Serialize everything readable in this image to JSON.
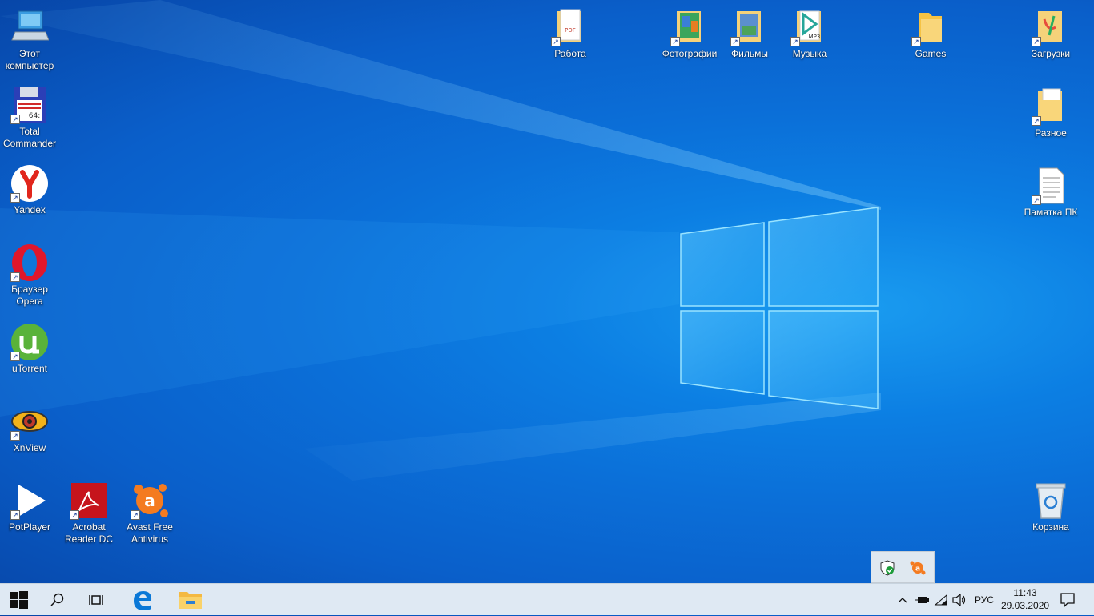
{
  "desktop": {
    "icons_left": [
      {
        "name": "this-pc",
        "label": "Этот компьютер"
      },
      {
        "name": "total-commander",
        "label": "Total Commander"
      },
      {
        "name": "yandex",
        "label": "Yandex"
      },
      {
        "name": "opera",
        "label": "Браузер Opera"
      },
      {
        "name": "utorrent",
        "label": "uTorrent"
      },
      {
        "name": "xnview",
        "label": "XnView"
      },
      {
        "name": "potplayer",
        "label": "PotPlayer"
      },
      {
        "name": "acrobat",
        "label": "Acrobat Reader DC"
      },
      {
        "name": "avast",
        "label": "Avast Free Antivirus"
      }
    ],
    "icons_top": [
      {
        "name": "rabota",
        "label": "Работа"
      },
      {
        "name": "photos",
        "label": "Фотографии"
      },
      {
        "name": "films",
        "label": "Фильмы"
      },
      {
        "name": "music",
        "label": "Музыка"
      },
      {
        "name": "games",
        "label": "Games"
      },
      {
        "name": "downloads",
        "label": "Загрузки"
      }
    ],
    "icons_right": [
      {
        "name": "raznoe",
        "label": "Разное"
      },
      {
        "name": "pamyatka",
        "label": "Памятка ПК"
      },
      {
        "name": "recycle-bin",
        "label": "Корзина"
      }
    ]
  },
  "taskbar": {
    "language": "РУС",
    "time": "11:43",
    "date": "29.03.2020"
  },
  "icon_glyphs": {
    "pdf": "PDF",
    "mp3": "MP3",
    "tc": "64:",
    "shortcut": "↗"
  },
  "colors": {
    "accent": "#0a78d7",
    "taskbar": "#dfe9f3"
  }
}
